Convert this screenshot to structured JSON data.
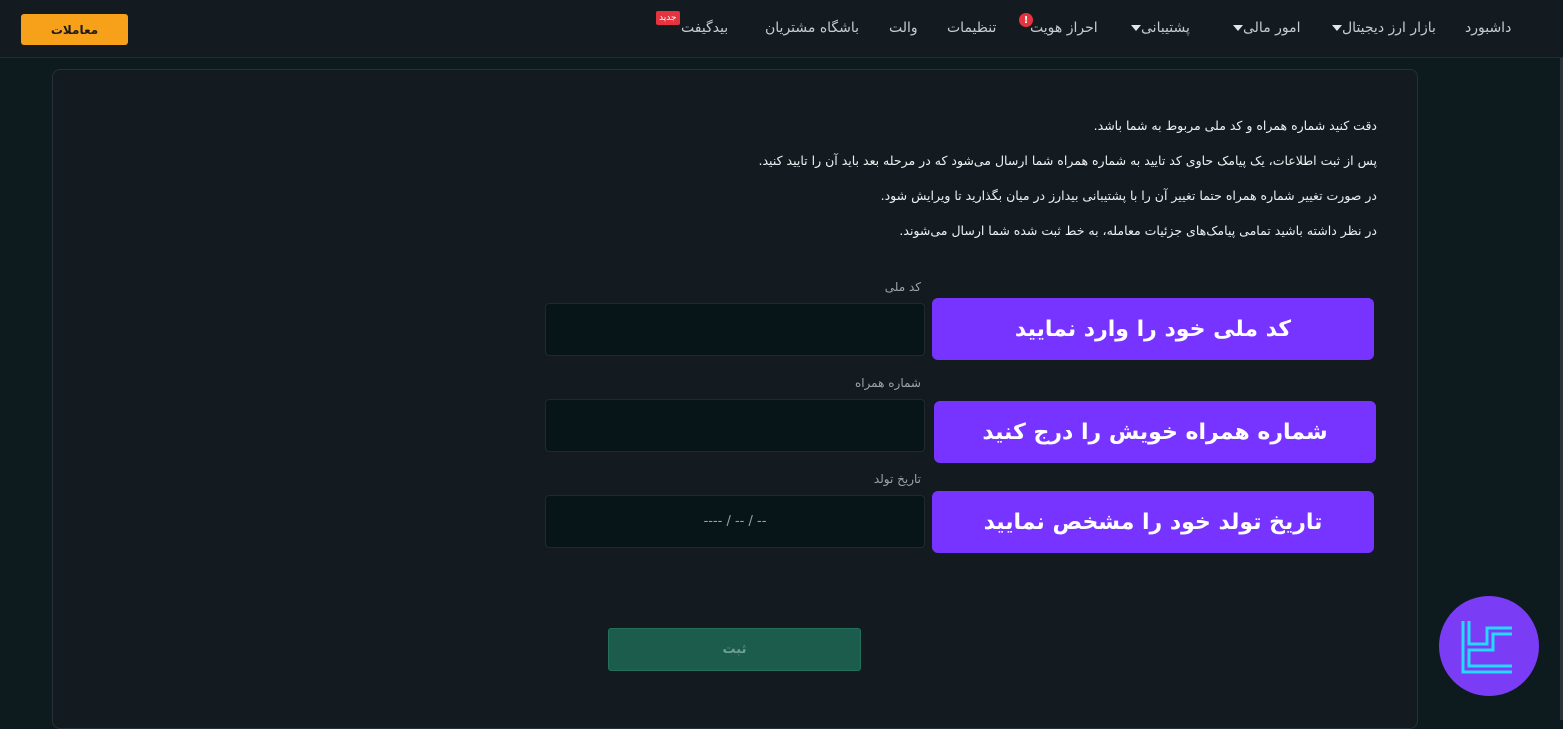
{
  "header": {
    "trade_button": "معاملات",
    "nav": {
      "dashboard": "داشبورد",
      "crypto_market": "بازار ارز دیجیتال",
      "finance": "امور مالی",
      "support": "پشتیبانی",
      "kyc": "احراز هویت",
      "settings": "تنظیمات",
      "wallet": "والت",
      "customers_club": "باشگاه مشتریان",
      "bidgift": "بیدگیفت"
    },
    "new_badge": "جدید",
    "alert_symbol": "!"
  },
  "notes": [
    "دقت کنید شماره همراه و کد ملی مربوط به شما باشد.",
    "پس از ثبت اطلاعات، یک پیامک حاوی کد تایید به شماره همراه شما ارسال می‌شود که در مرحله بعد باید آن را تایید کنید.",
    "در صورت تغییر شماره همراه حتما تغییر آن را با پشتیبانی بیدارز در میان بگذارید تا ویرایش شود.",
    "در نظر داشته باشید تمامی پیامک‌های جزئیات معامله، به خط ثبت شده شما ارسال می‌شوند."
  ],
  "form": {
    "national_id": {
      "label": "کد ملی",
      "value": ""
    },
    "mobile": {
      "label": "شماره همراه",
      "value": ""
    },
    "birth_date": {
      "label": "تاریخ تولد",
      "placeholder": "---- / -- / --"
    },
    "submit": "ثبت"
  },
  "callouts": {
    "national_id": "کد ملی خود را وارد نمایید",
    "mobile": "شماره همراه خویش را درج کنید",
    "birth_date": "تاریخ تولد خود را مشخص نمایید"
  },
  "colors": {
    "accent_orange": "#f7a11a",
    "callout_purple": "#7733ff",
    "submit_green": "#1b5c4c",
    "alert_red": "#e5333f"
  },
  "icons": {
    "caret": "caret-down-icon",
    "logo": "brand-logo-icon"
  }
}
